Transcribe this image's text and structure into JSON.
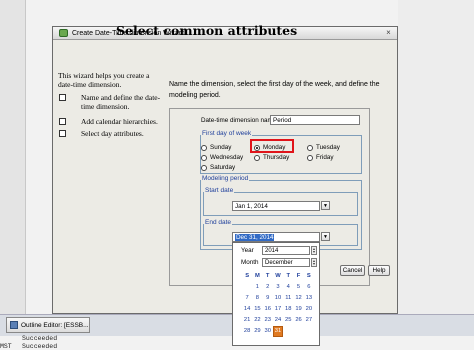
{
  "dialog": {
    "title": "Create Date-Time dimension Wizard",
    "close_glyph": "×",
    "heading": "Select common attributes"
  },
  "left_panel": {
    "intro": "This wizard helps you create a date-time dimension.",
    "steps": [
      {
        "label": "Name and define the date-time dimension.",
        "checked": false
      },
      {
        "label": "Add calendar hierarchies.",
        "checked": false
      },
      {
        "label": "Select day attributes.",
        "checked": false
      }
    ]
  },
  "instructions": "Name the dimension, select the first day of the week, and define the modeling period.",
  "dimension_name": {
    "label": "Date-time dimension name",
    "value": "Period"
  },
  "first_day": {
    "label": "First day of week",
    "selected": "Monday",
    "options": [
      "Sunday",
      "Monday",
      "Tuesday",
      "Wednesday",
      "Thursday",
      "Friday",
      "Saturday"
    ]
  },
  "modeling_period": {
    "label": "Modeling period",
    "start_label": "Start date",
    "start_value": "Jan 1, 2014",
    "end_label": "End date",
    "end_value": "Dec 31, 2014"
  },
  "buttons": {
    "cancel": "Cancel",
    "help": "Help",
    "partial_left": "<"
  },
  "calendar": {
    "year_label": "Year",
    "year_value": "2014",
    "month_label": "Month",
    "month_value": "December",
    "weekdays": [
      "S",
      "M",
      "T",
      "W",
      "T",
      "F",
      "S"
    ],
    "weeks": [
      [
        "",
        "1",
        "2",
        "3",
        "4",
        "5",
        "6"
      ],
      [
        "7",
        "8",
        "9",
        "10",
        "11",
        "12",
        "13"
      ],
      [
        "14",
        "15",
        "16",
        "17",
        "18",
        "19",
        "20"
      ],
      [
        "21",
        "22",
        "23",
        "24",
        "25",
        "26",
        "27"
      ],
      [
        "28",
        "29",
        "30",
        "31",
        "",
        "",
        ""
      ]
    ],
    "selected_day": "31"
  },
  "taskbar": {
    "button_label": "Outline Editor: [ESSB..."
  },
  "log": [
    {
      "col1": "",
      "col2": "Succeeded"
    },
    {
      "col1": "MST",
      "col2": "Succeeded"
    }
  ]
}
